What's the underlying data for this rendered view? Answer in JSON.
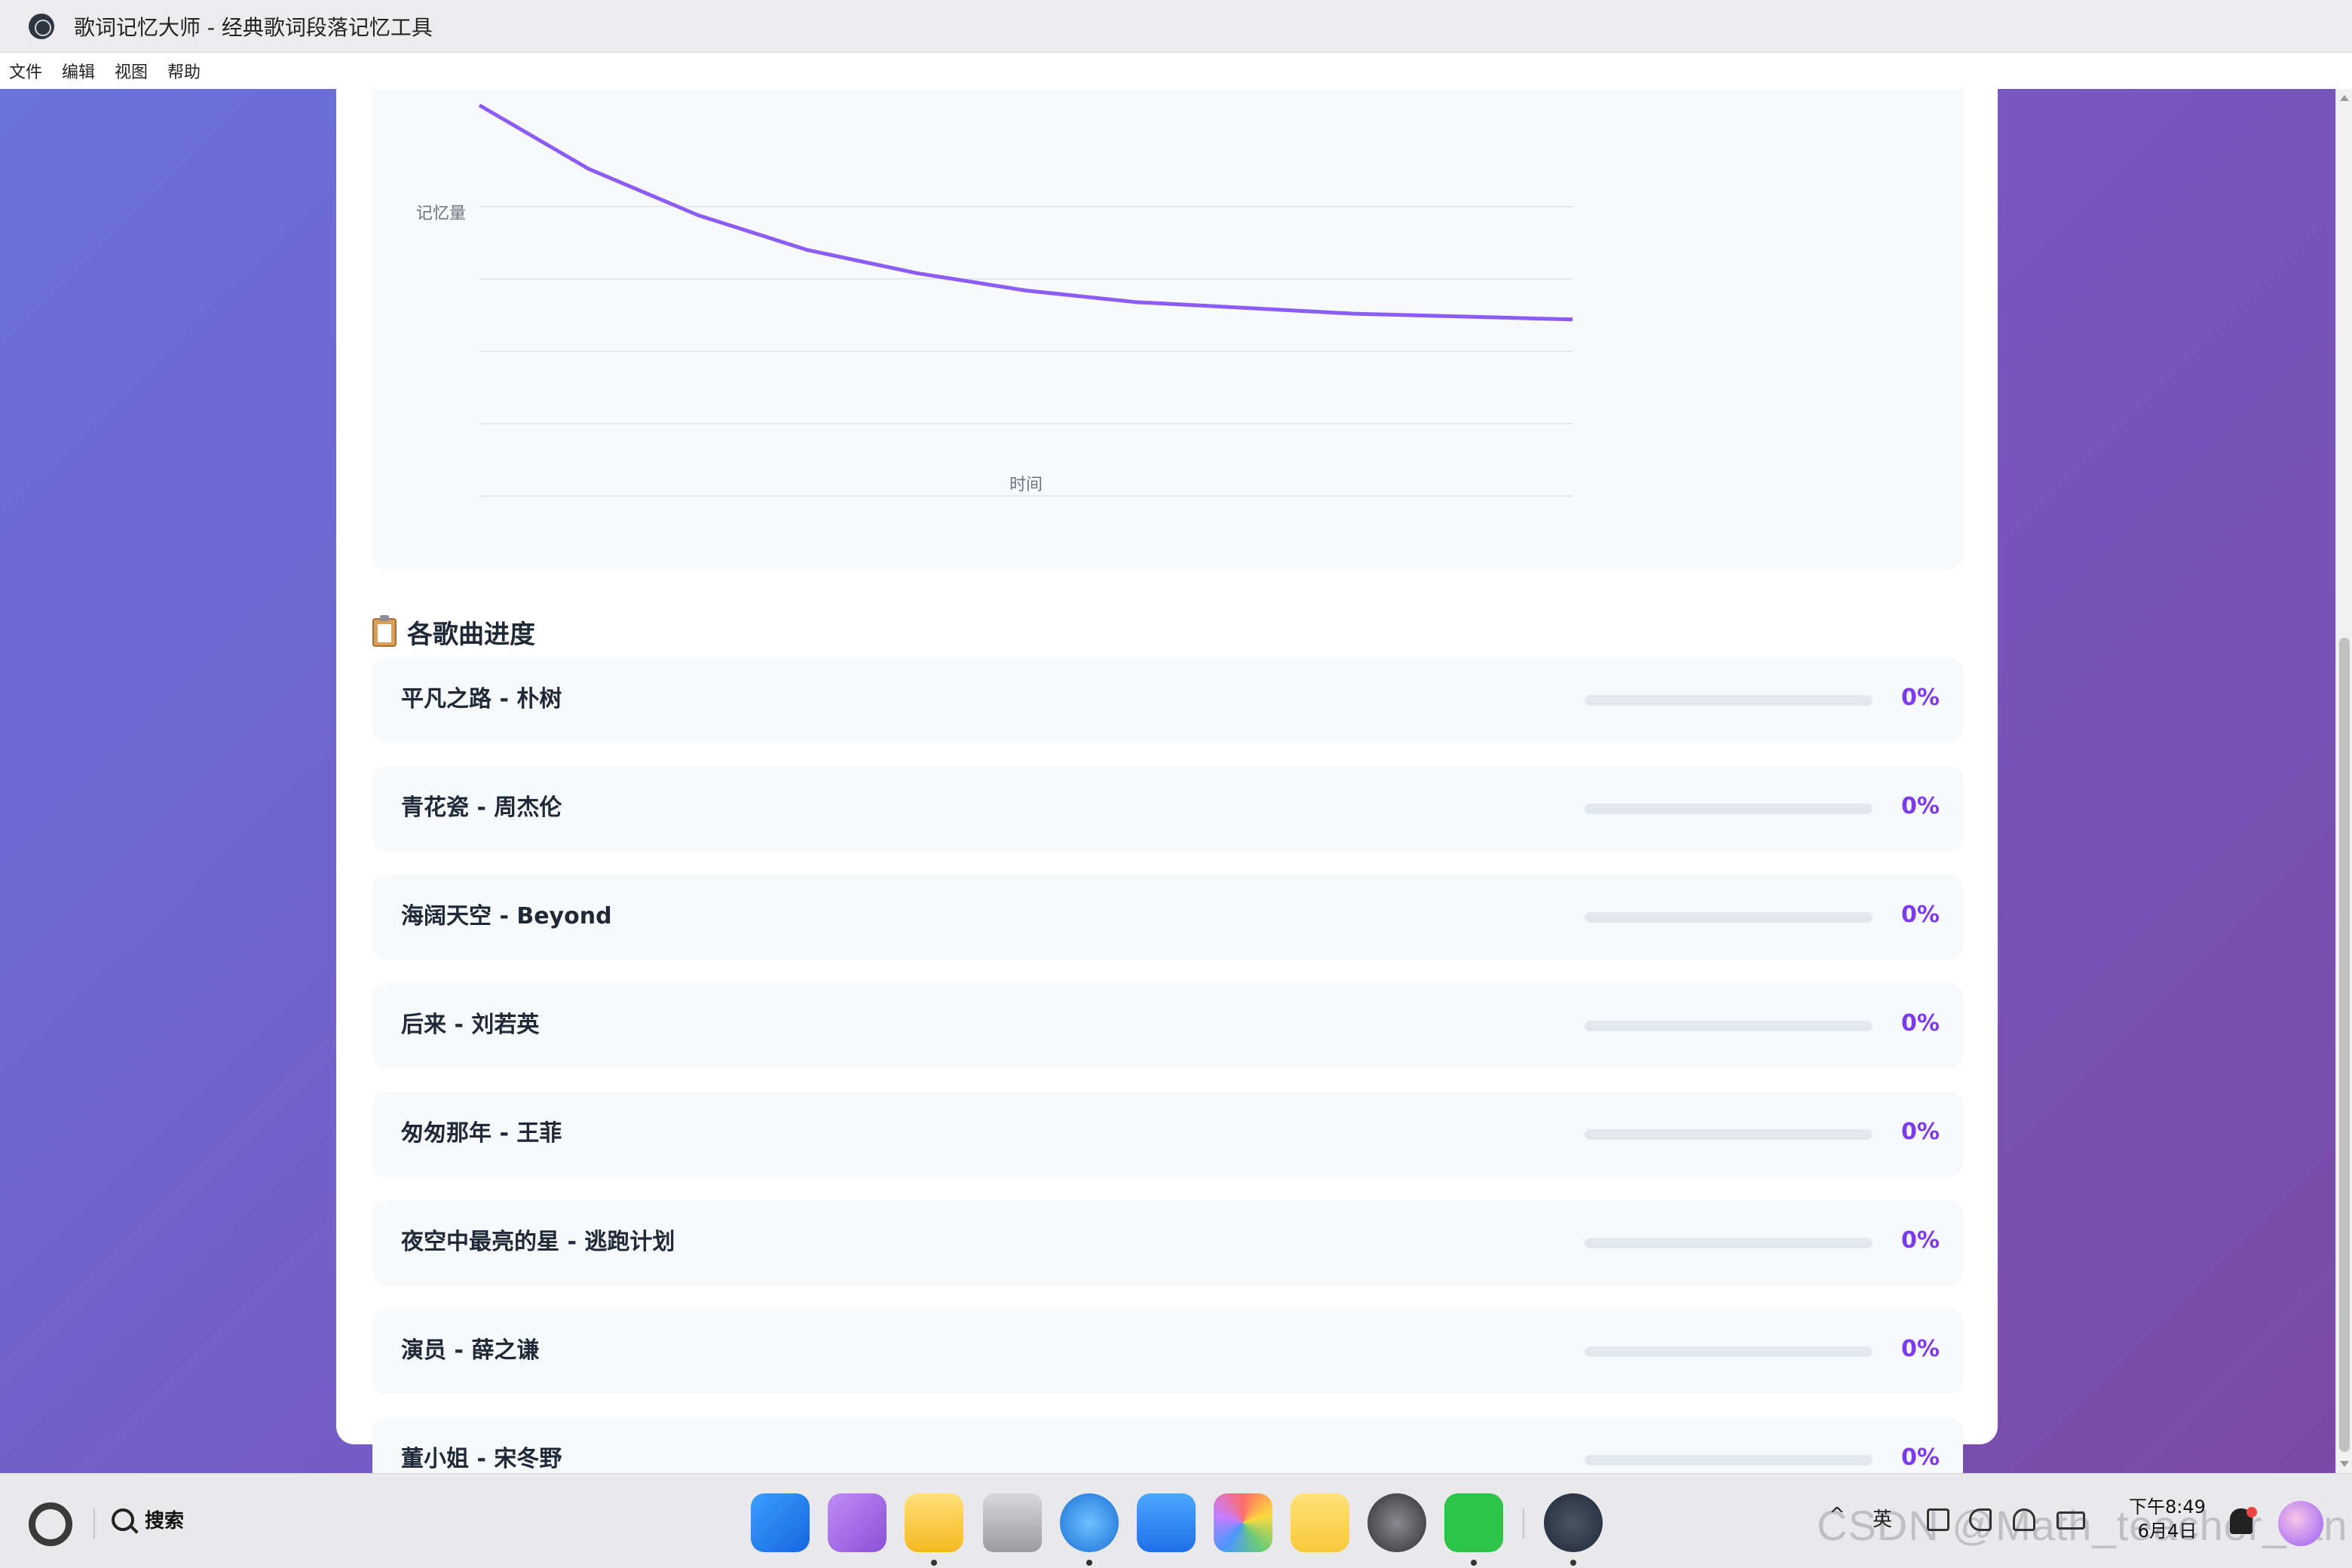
{
  "window": {
    "title": "歌词记忆大师 - 经典歌词段落记忆工具"
  },
  "menu": [
    "文件",
    "编辑",
    "视图",
    "帮助"
  ],
  "chart_data": {
    "type": "line",
    "title": "",
    "xlabel": "时间",
    "ylabel": "记忆量",
    "ylim": [
      0,
      100
    ],
    "grid": true,
    "legend": "none",
    "series": [
      {
        "x": [
          0,
          1,
          2,
          3,
          4,
          5,
          6,
          7,
          8,
          9,
          10
        ],
        "values": [
          110,
          88,
          72,
          60,
          52,
          46,
          42,
          40,
          38,
          37,
          36
        ],
        "color": "#8b5cf6"
      }
    ]
  },
  "progress_section": {
    "icon": "clipboard-icon",
    "title": "各歌曲进度",
    "songs": [
      {
        "name": "平凡之路 - 朴树",
        "progress": 0,
        "percent_label": "0%"
      },
      {
        "name": "青花瓷 - 周杰伦",
        "progress": 0,
        "percent_label": "0%"
      },
      {
        "name": "海阔天空 - Beyond",
        "progress": 0,
        "percent_label": "0%"
      },
      {
        "name": "后来 - 刘若英",
        "progress": 0,
        "percent_label": "0%"
      },
      {
        "name": "匆匆那年 - 王菲",
        "progress": 0,
        "percent_label": "0%"
      },
      {
        "name": "夜空中最亮的星 - 逃跑计划",
        "progress": 0,
        "percent_label": "0%"
      },
      {
        "name": "演员 - 薛之谦",
        "progress": 0,
        "percent_label": "0%"
      },
      {
        "name": "董小姐 - 宋冬野",
        "progress": 0,
        "percent_label": "0%"
      }
    ]
  },
  "taskbar": {
    "search_label": "搜索",
    "tray_ime": "英",
    "clock_time": "下午8:49",
    "clock_date": "6月4日",
    "watermark": "CSDN @Math_teacher_fan"
  },
  "colors": {
    "accent": "#8b5cf6",
    "accent_text": "#7c3aed",
    "background_start": "#6a72dc",
    "background_end": "#7a4aa8"
  }
}
